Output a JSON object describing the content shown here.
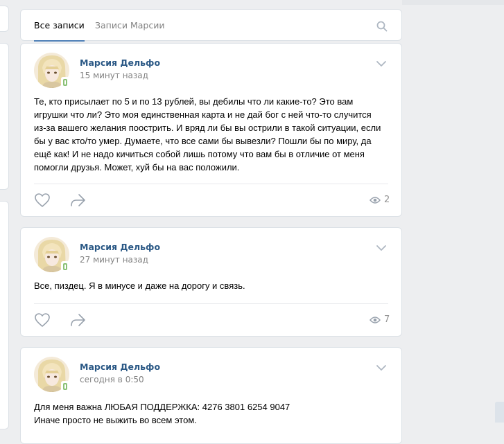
{
  "tabs": [
    {
      "label": "Все записи"
    },
    {
      "label": "Записи Марсии"
    }
  ],
  "posts": [
    {
      "author": "Марсия Дельфо",
      "time": "15 минут назад",
      "text": "Те, кто присылает по 5 и по 13 рублей, вы дебилы что ли какие-то? Это вам\nигрушки что ли? Это моя единственная карта и не дай бог с ней что-то случится\nиз-за вашего желания поострить. И вряд ли бы вы острили в такой ситуации, если\nбы у вас кто/то умер. Думаете, что все сами бы вывезли? Пошли бы по миру, да\nещё как! И не надо кичиться собой лишь потому что вам бы в отличие от меня\nпомогли друзья. Может, хуй бы на вас положили.",
      "views": "2"
    },
    {
      "author": "Марсия Дельфо",
      "time": "27 минут назад",
      "text": "Все, пиздец. Я в минусе и даже на дорогу и связь.",
      "views": "7"
    },
    {
      "author": "Марсия Дельфо",
      "time": "сегодня в 0:50",
      "text": "Для меня важна ЛЮБАЯ ПОДДЕРЖКА: 4276 3801 6254 9047\nИначе просто не выжить во всем этом."
    }
  ],
  "icons": {
    "search": "search-icon",
    "like": "heart-icon",
    "share": "share-arrow-icon",
    "views": "eye-icon",
    "menu": "chevron-down-icon"
  },
  "colors": {
    "background": "#edeef0",
    "link": "#2a5885",
    "accent": "#5181b8",
    "muted": "#828282",
    "online": "#8ac176"
  }
}
